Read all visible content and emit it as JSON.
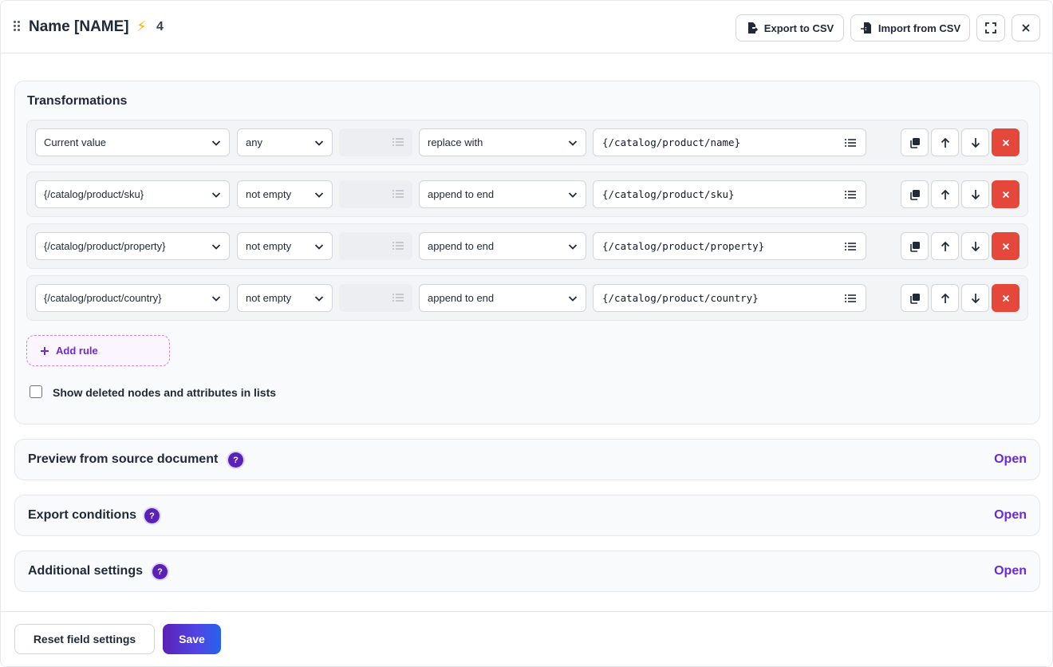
{
  "header": {
    "title": "Name [NAME]",
    "bolt_icon": "lightning-icon",
    "count": "4",
    "export_label": "Export to CSV",
    "import_label": "Import from CSV"
  },
  "transformations": {
    "title": "Transformations",
    "rules": [
      {
        "source": "Current value",
        "condition": "any",
        "action": "replace with",
        "value": "{/catalog/product/name}"
      },
      {
        "source": "{/catalog/product/sku}",
        "condition": "not empty",
        "action": "append to end",
        "value": "{/catalog/product/sku}"
      },
      {
        "source": "{/catalog/product/property}",
        "condition": "not empty",
        "action": "append to end",
        "value": "{/catalog/product/property}"
      },
      {
        "source": "{/catalog/product/country}",
        "condition": "not empty",
        "action": "append to end",
        "value": "{/catalog/product/country}"
      }
    ],
    "add_rule_label": "Add rule",
    "show_deleted_label": "Show deleted nodes and attributes in lists",
    "show_deleted_checked": false
  },
  "sections": [
    {
      "title": "Preview from source document",
      "open_label": "Open"
    },
    {
      "title": "Export conditions",
      "open_label": "Open"
    },
    {
      "title": "Additional settings",
      "open_label": "Open"
    }
  ],
  "footer": {
    "reset_label": "Reset field settings",
    "save_label": "Save"
  },
  "colors": {
    "accent": "#6d28d9",
    "delete": "#e5483b",
    "bolt": "#f5b400"
  }
}
